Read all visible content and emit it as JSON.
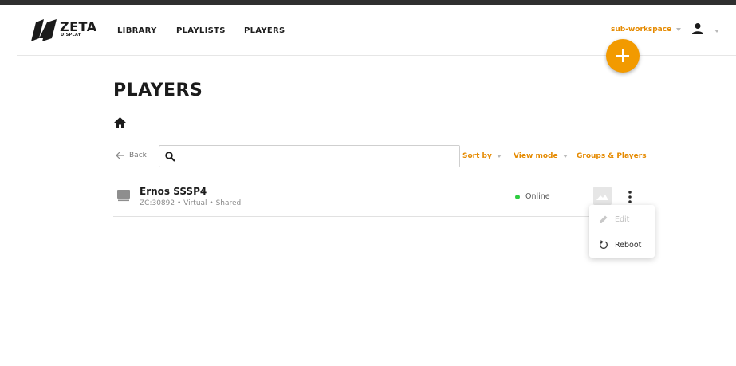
{
  "brand": {
    "name": "ZETA",
    "tagline": "DISPLAY",
    "accent": "#f29a00",
    "accent_text": "#e58a00"
  },
  "nav": {
    "items": [
      {
        "label": "LIBRARY"
      },
      {
        "label": "PLAYLISTS"
      },
      {
        "label": "PLAYERS"
      }
    ]
  },
  "header": {
    "workspace": "sub-workspace",
    "user_icon": "user-icon",
    "add_icon": "plus-icon"
  },
  "page": {
    "title": "PLAYERS",
    "home_icon": "home-icon"
  },
  "toolbar": {
    "back_label": "Back",
    "search": {
      "value": "",
      "placeholder": ""
    },
    "sort_label": "Sort by",
    "view_mode_label": "View mode",
    "groups_label": "Groups & Players"
  },
  "players": [
    {
      "name": "Ernos SSSP4",
      "meta": "ZC:30892 • Virtual • Shared",
      "status": "Online",
      "status_color": "#2ecc40"
    }
  ],
  "context_menu": {
    "items": [
      {
        "label": "Edit",
        "icon": "pencil-icon",
        "disabled": true
      },
      {
        "label": "Reboot",
        "icon": "reboot-icon",
        "disabled": false
      }
    ]
  }
}
